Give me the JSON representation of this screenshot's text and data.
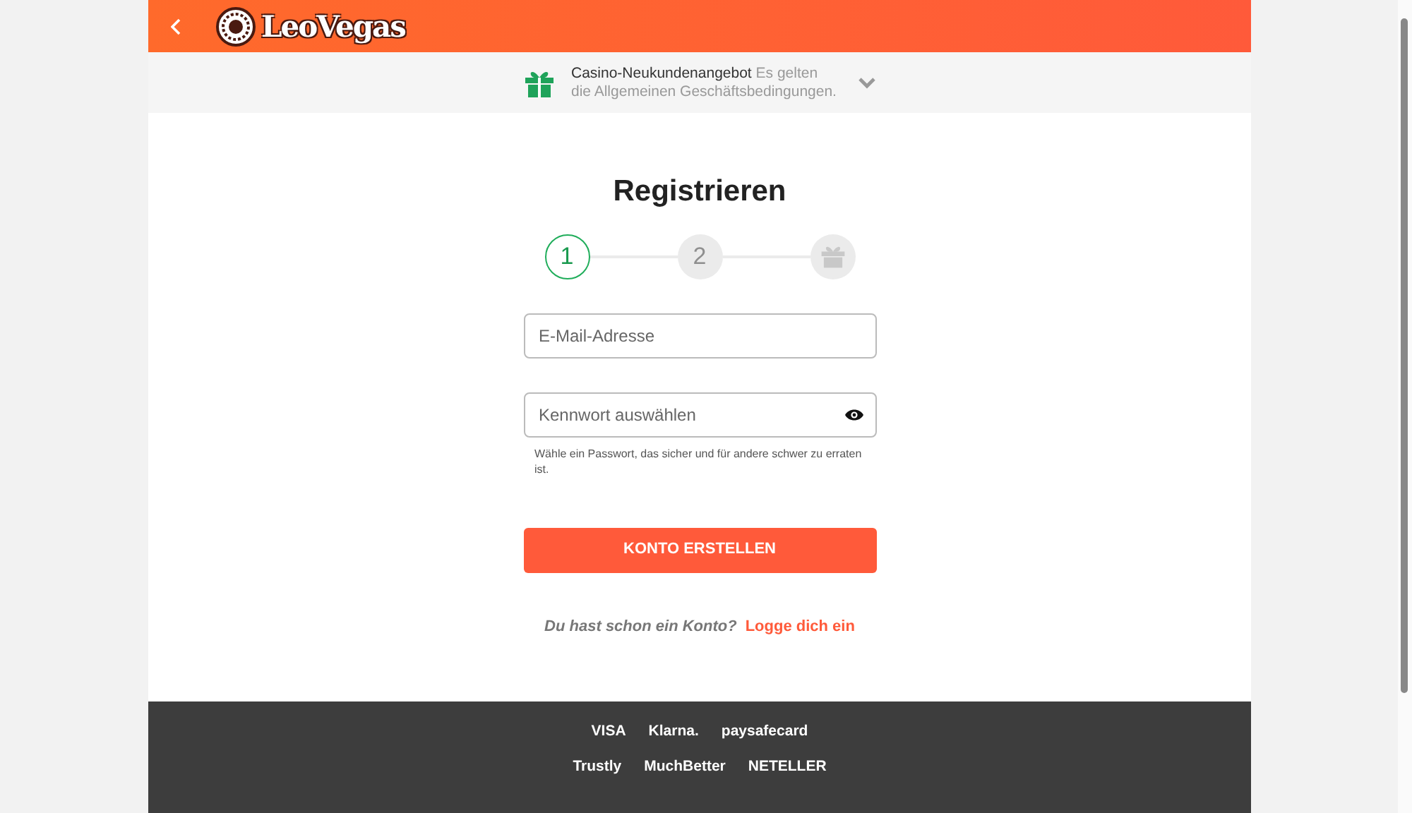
{
  "header": {
    "logo_text": "LeoVegas"
  },
  "offer": {
    "title": "Casino-Neukundenangebot",
    "text": "Es gelten die Allgemeinen Geschäftsbedingungen.",
    "expanded": false
  },
  "form": {
    "title": "Registrieren",
    "steps": [
      {
        "kind": "number",
        "label": "1",
        "active": true
      },
      {
        "kind": "number",
        "label": "2",
        "active": false
      },
      {
        "kind": "gift",
        "active": false
      }
    ],
    "email": {
      "placeholder": "E-Mail-Adresse"
    },
    "password": {
      "placeholder": "Kennwort auswählen",
      "hint": "Wähle ein Passwort, das sicher und für andere schwer zu erraten ist."
    },
    "submit": "KONTO ERSTELLEN",
    "login_prompt": "Du hast schon ein Konto?",
    "login_link": "Logge dich ein"
  },
  "footer": {
    "payment_logos": [
      [
        "VISA",
        "Klarna.",
        "paysafecard"
      ],
      [
        "Trustly",
        "MuchBetter",
        "NETELLER"
      ]
    ]
  }
}
